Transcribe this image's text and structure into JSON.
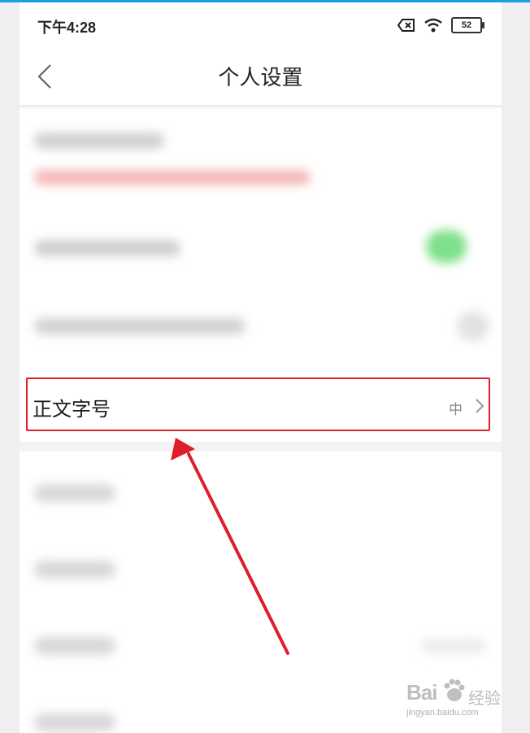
{
  "status_bar": {
    "time": "下午4:28",
    "battery_level": "52"
  },
  "navbar": {
    "title": "个人设置"
  },
  "settings": {
    "font_size_row": {
      "label": "正文字号",
      "value": "中"
    }
  },
  "watermark": {
    "brand": "Bai",
    "brand_cn": "经验",
    "url": "jingyan.baidu.com"
  },
  "colors": {
    "highlight": "#e01e2a",
    "toggle_on": "#4cd964",
    "accent_top": "#1aa0e8"
  },
  "icons": [
    "back-icon",
    "sim-off-icon",
    "wifi-icon",
    "battery-icon",
    "chevron-right-icon",
    "annotation-arrow"
  ]
}
